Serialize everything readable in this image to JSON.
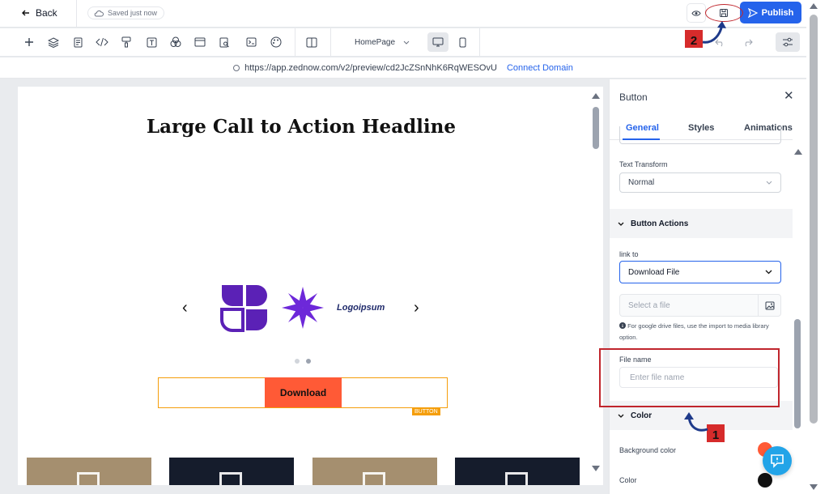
{
  "header": {
    "back_label": "Back",
    "save_status": "Saved just now",
    "publish_label": "Publish"
  },
  "toolbar": {
    "page_select": "HomePage",
    "tools": [
      "add-icon",
      "layers-icon",
      "pages-icon",
      "code-icon",
      "paint-roller-icon",
      "text-icon",
      "blend-icon",
      "layout-icon",
      "search-page-icon",
      "terminal-icon",
      "palette-icon",
      "columns-icon"
    ]
  },
  "urlbar": {
    "url": "https://app.zednow.com/v2/preview/cd2JcZSnNhK6RqWESOvU",
    "connect_label": "Connect Domain"
  },
  "canvas": {
    "headline": "Large Call to Action Headline",
    "logo_text": "Logoipsum",
    "button_label": "Download",
    "element_tag": "BUTTON",
    "thumb_colors": [
      "#a58f6f",
      "#151c2c",
      "#a58f6f",
      "#151c2c"
    ]
  },
  "panel": {
    "title": "Button",
    "tabs": [
      "General",
      "Styles",
      "Animations"
    ],
    "active_tab": "General",
    "text_transform_label": "Text Transform",
    "text_transform_value": "Normal",
    "button_actions_label": "Button Actions",
    "link_to_label": "link to",
    "link_to_value": "Download File",
    "file_placeholder": "Select a file",
    "help_text": "For google drive files, use the import to media library option.",
    "file_name_label": "File name",
    "file_name_placeholder": "Enter file name",
    "color_section_label": "Color",
    "background_color_label": "Background color",
    "color_label": "Color",
    "background_color": "#ff5a36",
    "text_color": "#111111"
  },
  "annotations": {
    "step1": "1",
    "step2": "2",
    "accent": "#c0262d"
  }
}
